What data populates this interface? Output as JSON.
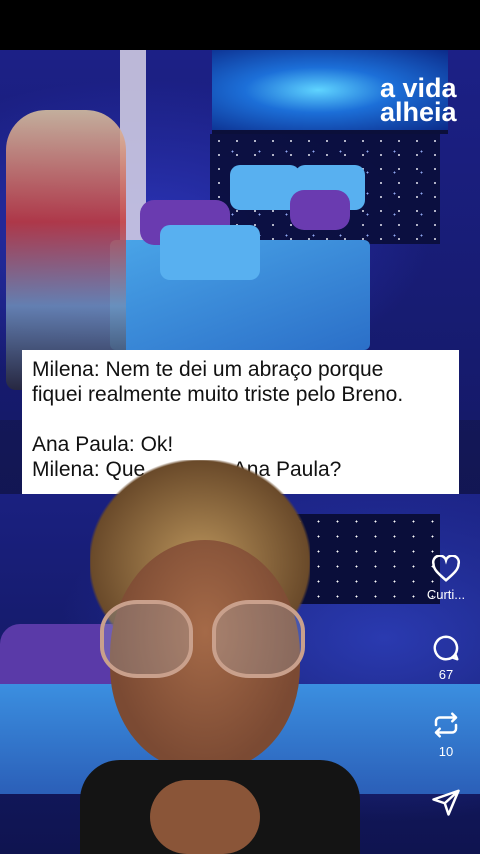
{
  "watermark": {
    "line1": "a vida",
    "line2": "alheia"
  },
  "caption": {
    "line1": "Milena: Nem te dei um abraço porque",
    "line2": "fiquei realmente muito triste pelo Breno.",
    "line3": "Ana Paula: Ok!",
    "line4": "Milena: Que … esse, Ana Paula?"
  },
  "actions": {
    "like_label": "Curti...",
    "comment_count": "67",
    "repost_count": "10"
  },
  "icons": {
    "like": "heart-icon",
    "comment": "comment-bubble-icon",
    "repost": "repost-arrows-icon",
    "share": "send-icon"
  }
}
